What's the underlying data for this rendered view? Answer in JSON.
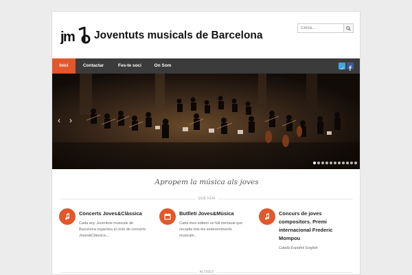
{
  "header": {
    "site_title": "Joventuts musicals de Barcelona",
    "logo_text": "jmb",
    "search_placeholder": "Cerca..."
  },
  "nav": {
    "items": [
      {
        "label": "Inici",
        "active": true
      },
      {
        "label": "Contactar",
        "active": false
      },
      {
        "label": "Fes-te soci",
        "active": false
      },
      {
        "label": "On Som",
        "active": false
      }
    ],
    "social": [
      {
        "icon": "twitter-icon",
        "glyph": "t",
        "color": "#3fa8d8"
      },
      {
        "icon": "facebook-icon",
        "glyph": "f",
        "color": "#3b5998"
      }
    ]
  },
  "slider": {
    "prev_glyph": "‹",
    "next_glyph": "›",
    "slide_count": 11,
    "active_slide": 1
  },
  "tagline": "Apropem la música als joves",
  "sections": {
    "que_fem": "QUÈ FEM",
    "altres": "ALTRES"
  },
  "features": [
    {
      "icon": "music-note-icon",
      "title": "Concerts Joves&Clàssica",
      "text": "Cada any Joventuts musicals de Barcelona organitza el cicle de concerts Joves&Clàssica...."
    },
    {
      "icon": "calendar-icon",
      "title": "Butlletí Joves&Música",
      "text": "Cada mes editem un full mensual que recopila tots els esdeveniments musicals..."
    },
    {
      "icon": "music-note-icon",
      "title": "Concurs de joves compositors. Premi internacional Frederic Mompou",
      "text": "Català Español English"
    }
  ],
  "colors": {
    "accent": "#e2572b",
    "nav_bg": "#3b3b3b"
  }
}
